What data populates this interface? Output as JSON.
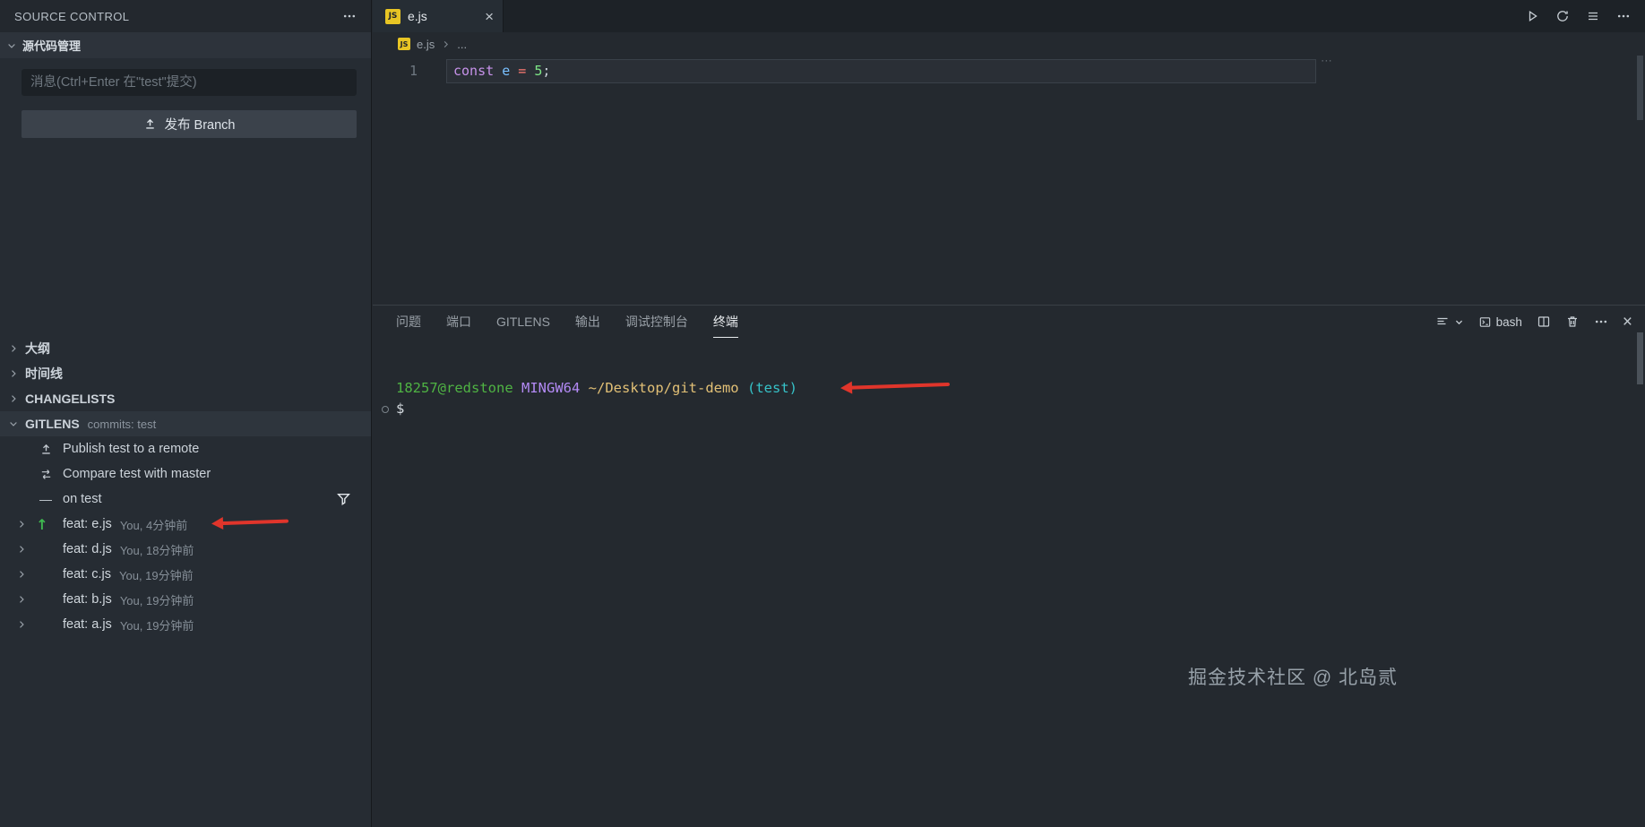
{
  "sidebar": {
    "title": "SOURCE CONTROL",
    "scm": {
      "header": "源代码管理",
      "message_placeholder": "消息(Ctrl+Enter 在\"test\"提交)",
      "publish_button": "发布 Branch"
    },
    "sections": {
      "outline": "大纲",
      "timeline": "时间线",
      "changelists": "CHANGELISTS",
      "gitlens": "GITLENS",
      "gitlens_desc": "commits: test"
    },
    "gitlens": {
      "items": [
        {
          "label": "Publish test to a remote",
          "icon": "cloud-upload-icon"
        },
        {
          "label": "Compare test with master",
          "icon": "compare-icon"
        },
        {
          "label": "on test",
          "icon": "dash-icon"
        }
      ],
      "dash": "—",
      "commits": [
        {
          "label": "feat: e.js",
          "desc": "You, 4分钟前",
          "ahead_arrow": "↑"
        },
        {
          "label": "feat: d.js",
          "desc": "You, 18分钟前"
        },
        {
          "label": "feat: c.js",
          "desc": "You, 19分钟前"
        },
        {
          "label": "feat: b.js",
          "desc": "You, 19分钟前"
        },
        {
          "label": "feat: a.js",
          "desc": "You, 19分钟前"
        }
      ]
    }
  },
  "editor": {
    "tab_label": "e.js",
    "js_badge": "JS",
    "close_glyph": "×",
    "breadcrumb_file": "e.js",
    "breadcrumb_more": "...",
    "overflow_hint": "⋯",
    "line_number": "1",
    "code": {
      "keyword": "const",
      "variable": "e",
      "operator": "=",
      "number": "5",
      "semicolon": ";"
    }
  },
  "panel": {
    "tabs": [
      "问题",
      "端口",
      "GITLENS",
      "输出",
      "调试控制台",
      "终端"
    ],
    "active_tab": "终端",
    "shell": "bash",
    "close_glyph": "×",
    "terminal": {
      "user_host": "18257@redstone",
      "env": "MINGW64",
      "path": "~/Desktop/git-demo",
      "branch": "(test)",
      "prompt": "$"
    }
  },
  "watermark": "掘金技术社区 @ 北岛贰",
  "colors": {
    "annotation_red": "#e0352b",
    "terminal_green": "#4fb343",
    "terminal_purple": "#b38af5",
    "terminal_yellow": "#e2c076",
    "terminal_cyan": "#36c2c8",
    "gitlens_ahead_green": "#3fb950",
    "js_badge_yellow": "#e8c524"
  }
}
